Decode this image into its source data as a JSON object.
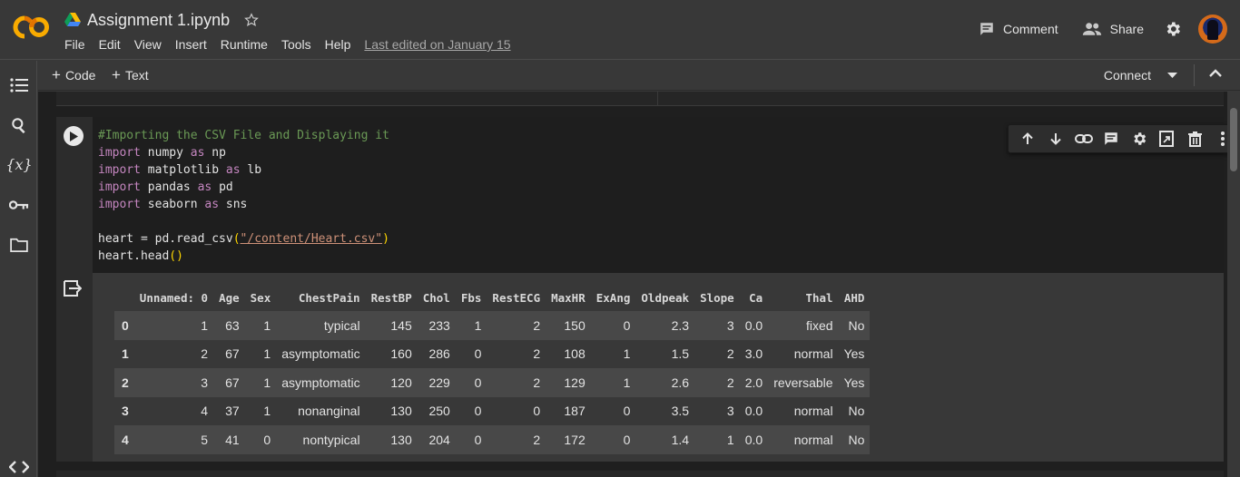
{
  "app": {
    "logo": "CO",
    "title": "Assignment 1.ipynb",
    "last_edited": "Last edited on January 15",
    "colors": {
      "logo_orange": "#f9ab00",
      "logo_dark_orange": "#e37400"
    }
  },
  "menu": [
    "File",
    "Edit",
    "View",
    "Insert",
    "Runtime",
    "Tools",
    "Help"
  ],
  "header_actions": {
    "comment": "Comment",
    "share": "Share"
  },
  "toolbar": {
    "add_code": "Code",
    "add_text": "Text",
    "connect": "Connect"
  },
  "rail": {
    "icons": [
      "table-of-contents-icon",
      "search-icon",
      "variables-icon",
      "secrets-key-icon",
      "files-folder-icon",
      "code-snippets-icon"
    ],
    "variables_glyph": "{x}"
  },
  "cell_toolbar": {
    "icons": [
      "move-up-icon",
      "move-down-icon",
      "link-icon",
      "comment-icon",
      "settings-icon",
      "mirror-cell-icon",
      "delete-icon",
      "more-icon"
    ]
  },
  "code": {
    "line1_comment": "#Importing the CSV File and Displaying it",
    "lines": [
      {
        "kw": "import",
        "mod": " numpy ",
        "kw2": "as",
        "alias": " np"
      },
      {
        "kw": "import",
        "mod": " matplotlib ",
        "kw2": "as",
        "alias": " lb"
      },
      {
        "kw": "import",
        "mod": " pandas ",
        "kw2": "as",
        "alias": " pd"
      },
      {
        "kw": "import",
        "mod": " seaborn ",
        "kw2": "as",
        "alias": " sns"
      }
    ],
    "read_prefix": "heart = pd.read_csv",
    "read_open": "(",
    "read_str": "\"/content/Heart.csv\"",
    "read_close": ")",
    "head_prefix": "heart.head",
    "head_parens": "()"
  },
  "table": {
    "columns": [
      "",
      "Unnamed: 0",
      "Age",
      "Sex",
      "ChestPain",
      "RestBP",
      "Chol",
      "Fbs",
      "RestECG",
      "MaxHR",
      "ExAng",
      "Oldpeak",
      "Slope",
      "Ca",
      "Thal",
      "AHD"
    ],
    "rows": [
      [
        "0",
        "1",
        "63",
        "1",
        "typical",
        "145",
        "233",
        "1",
        "2",
        "150",
        "0",
        "2.3",
        "3",
        "0.0",
        "fixed",
        "No"
      ],
      [
        "1",
        "2",
        "67",
        "1",
        "asymptomatic",
        "160",
        "286",
        "0",
        "2",
        "108",
        "1",
        "1.5",
        "2",
        "3.0",
        "normal",
        "Yes"
      ],
      [
        "2",
        "3",
        "67",
        "1",
        "asymptomatic",
        "120",
        "229",
        "0",
        "2",
        "129",
        "1",
        "2.6",
        "2",
        "2.0",
        "reversable",
        "Yes"
      ],
      [
        "3",
        "4",
        "37",
        "1",
        "nonanginal",
        "130",
        "250",
        "0",
        "0",
        "187",
        "0",
        "3.5",
        "3",
        "0.0",
        "normal",
        "No"
      ],
      [
        "4",
        "5",
        "41",
        "0",
        "nontypical",
        "130",
        "204",
        "0",
        "2",
        "172",
        "0",
        "1.4",
        "1",
        "0.0",
        "normal",
        "No"
      ]
    ]
  }
}
